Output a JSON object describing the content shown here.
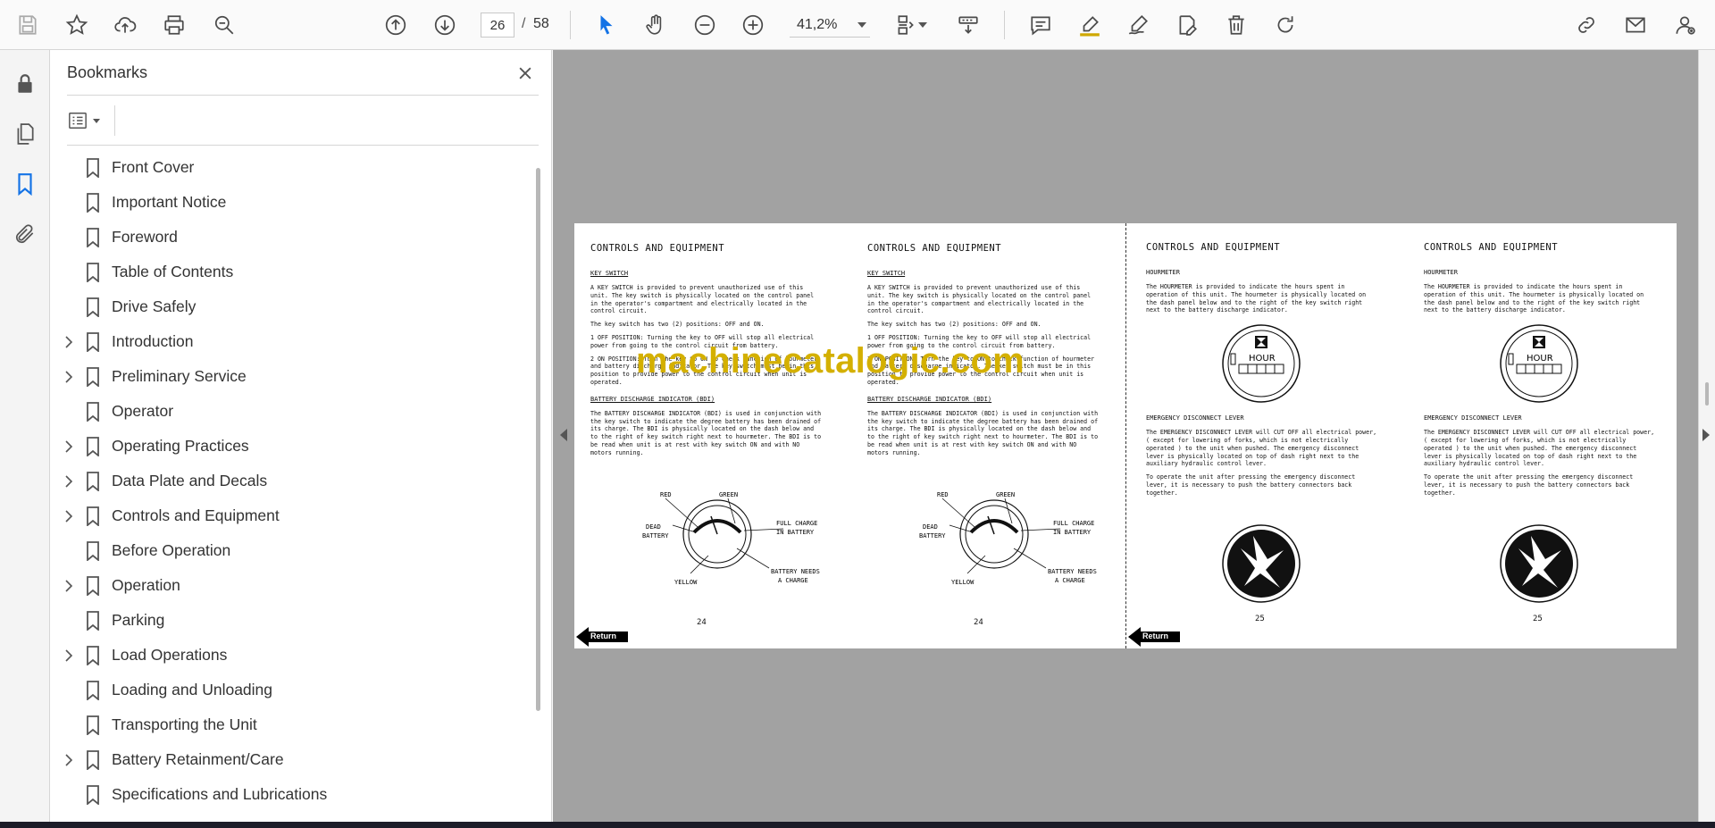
{
  "toolbar": {
    "current_page": "26",
    "page_separator": "/",
    "total_pages": "58",
    "zoom": "41,2%"
  },
  "bookmarks": {
    "title": "Bookmarks",
    "items": [
      {
        "label": "Front Cover",
        "expandable": false
      },
      {
        "label": "Important Notice",
        "expandable": false
      },
      {
        "label": "Foreword",
        "expandable": false
      },
      {
        "label": "Table of Contents",
        "expandable": false
      },
      {
        "label": "Drive Safely",
        "expandable": false
      },
      {
        "label": "Introduction",
        "expandable": true
      },
      {
        "label": "Preliminary Service",
        "expandable": true
      },
      {
        "label": "Operator",
        "expandable": false
      },
      {
        "label": "Operating Practices",
        "expandable": true
      },
      {
        "label": "Data Plate and Decals",
        "expandable": true
      },
      {
        "label": "Controls and Equipment",
        "expandable": true
      },
      {
        "label": "Before Operation",
        "expandable": false
      },
      {
        "label": "Operation",
        "expandable": true
      },
      {
        "label": "Parking",
        "expandable": false
      },
      {
        "label": "Load Operations",
        "expandable": true
      },
      {
        "label": "Loading and Unloading",
        "expandable": false
      },
      {
        "label": "Transporting the Unit",
        "expandable": false
      },
      {
        "label": "Battery Retainment/Care",
        "expandable": true
      },
      {
        "label": "Specifications and Lubrications",
        "expandable": false
      }
    ]
  },
  "document": {
    "watermark": "machinecatalogic.com",
    "return_label": "Return",
    "left_sheet": {
      "heading": "CONTROLS AND EQUIPMENT",
      "key_switch_title": "KEY SWITCH",
      "key_switch_p1": "A KEY SWITCH is provided to prevent unauthorized use of this unit. The key switch is physically located on the control panel in the operator's compartment and electrically located in the control circuit.",
      "key_switch_p2": "The key switch has two (2) positions: OFF and ON.",
      "off_position": "1   OFF POSITION: Turning the key to OFF will stop all electrical power from going to the control circuit from battery.",
      "on_position": "2   ON POSITION: Turn the key to ON to check function of hourmeter and battery discharge indicator. The key switch must be in this position to provide power to the control circuit when unit is operated.",
      "bdi_title": "BATTERY DISCHARGE INDICATOR (BDI)",
      "bdi_text": "The BATTERY DISCHARGE INDICATOR (BDI) is used in conjunction with the key switch to indicate the degree battery has been drained of its charge. The BDI is physically located on the dash below and to the right of key switch right next to hourmeter. The BDI is to be read when unit is at rest with key switch ON and with NO motors running.",
      "gauge_labels": {
        "red": "RED",
        "green": "GREEN",
        "dead": "DEAD",
        "battery": "BATTERY",
        "full": "FULL CHARGE",
        "in_battery": "IN BATTERY",
        "yellow": "YELLOW",
        "needs": "BATTERY NEEDS",
        "a_charge": "A CHARGE"
      },
      "page_number": "24"
    },
    "right_sheet": {
      "heading": "CONTROLS AND EQUIPMENT",
      "hourmeter_title": "HOURMETER",
      "hourmeter_text": "The HOURMETER is provided to indicate the hours spent in operation of this unit. The hourmeter is physically located on the dash panel below and to the right of the key switch right next to the battery discharge indicator.",
      "hour_label": "HOUR",
      "edl_title": "EMERGENCY DISCONNECT LEVER",
      "edl_text1": "The EMERGENCY DISCONNECT LEVER will CUT OFF all electrical power, ( except for lowering of forks, which is not electrically operated ) to the unit when pushed. The emergency disconnect lever is physically located on top of dash right next to the auxiliary hydraulic control lever.",
      "edl_text2": "To operate the unit after pressing the emergency disconnect lever, it is necessary to push the battery connectors back together.",
      "page_number": "25"
    }
  }
}
